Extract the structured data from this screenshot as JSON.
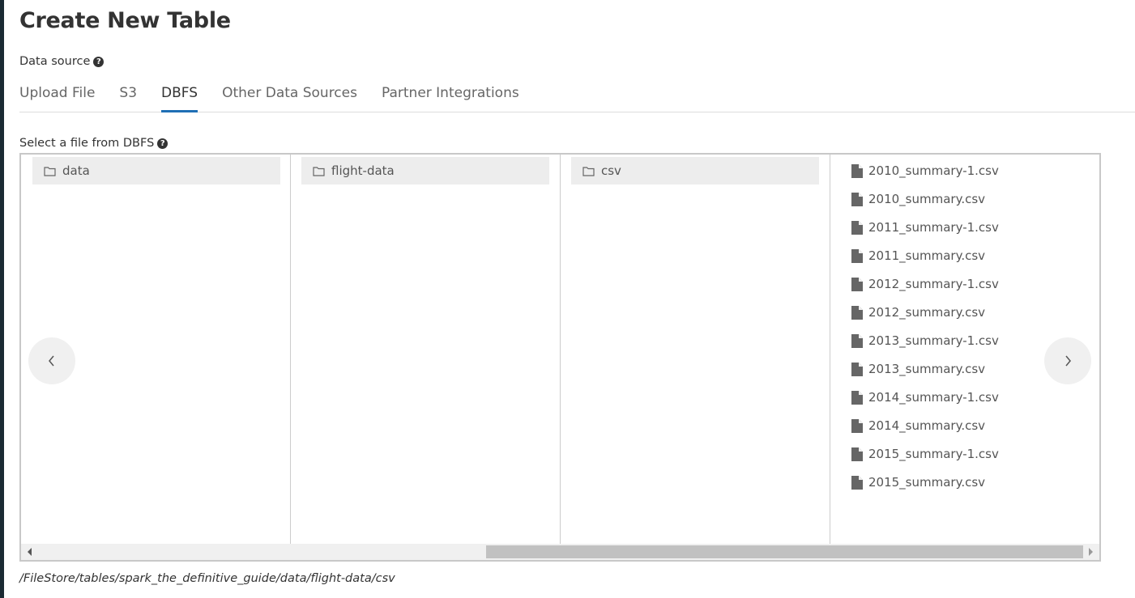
{
  "page": {
    "title": "Create New Table"
  },
  "data_source": {
    "label": "Data source",
    "help_icon": "question-circle-icon",
    "tabs": [
      {
        "label": "Upload File",
        "active": false
      },
      {
        "label": "S3",
        "active": false
      },
      {
        "label": "DBFS",
        "active": true
      },
      {
        "label": "Other Data Sources",
        "active": false
      },
      {
        "label": "Partner Integrations",
        "active": false
      }
    ],
    "accent_color": "#1f6fb5"
  },
  "file_browser": {
    "label": "Select a file from DBFS",
    "help_icon": "question-circle-icon",
    "columns": [
      {
        "type": "folder",
        "selected": "data",
        "icon": "folder-icon"
      },
      {
        "type": "folder",
        "selected": "flight-data",
        "icon": "folder-icon"
      },
      {
        "type": "folder",
        "selected": "csv",
        "icon": "folder-icon"
      },
      {
        "type": "files",
        "icon": "file-icon",
        "items": [
          "2010_summary-1.csv",
          "2010_summary.csv",
          "2011_summary-1.csv",
          "2011_summary.csv",
          "2012_summary-1.csv",
          "2012_summary.csv",
          "2013_summary-1.csv",
          "2013_summary.csv",
          "2014_summary-1.csv",
          "2014_summary.csv",
          "2015_summary-1.csv",
          "2015_summary.csv"
        ]
      }
    ],
    "prev_icon": "chevron-left-icon",
    "next_icon": "chevron-right-icon"
  },
  "current_path": "/FileStore/tables/spark_the_definitive_guide/data/flight-data/csv"
}
